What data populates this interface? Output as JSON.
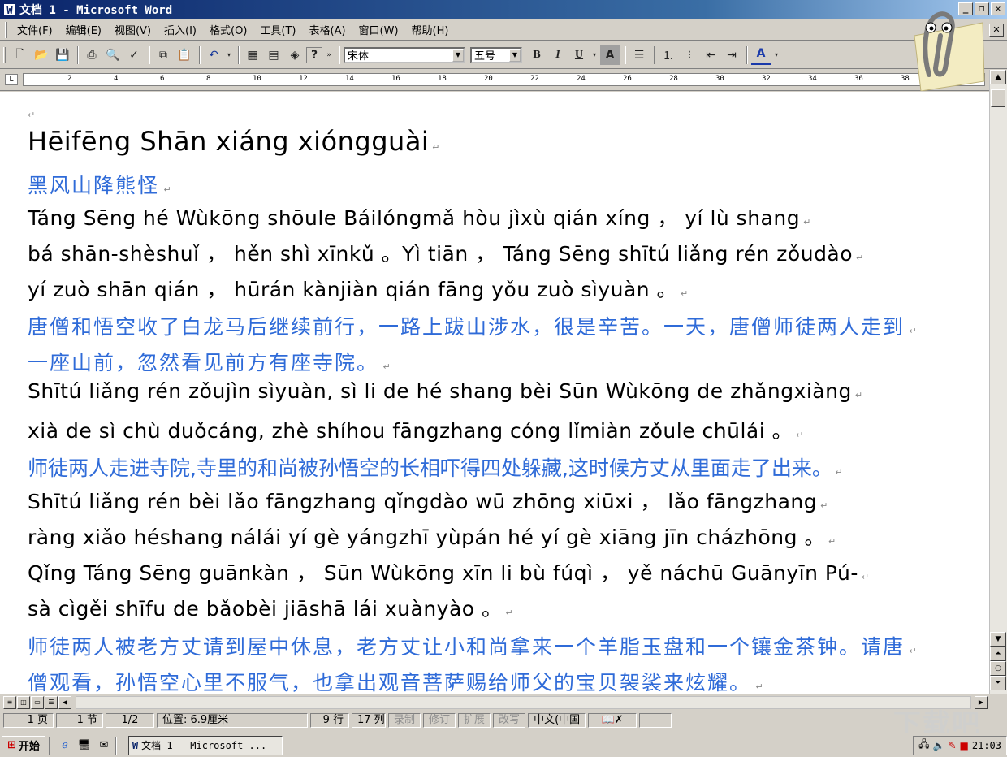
{
  "window": {
    "title": "文档 1 - Microsoft Word",
    "icon": "word-icon"
  },
  "menus": [
    "文件(F)",
    "编辑(E)",
    "视图(V)",
    "插入(I)",
    "格式(O)",
    "工具(T)",
    "表格(A)",
    "窗口(W)",
    "帮助(H)"
  ],
  "toolbar": {
    "font": "宋体",
    "size": "五号",
    "bold": "B",
    "italic": "I",
    "underline": "U",
    "shade": "A",
    "fontcolor": "A"
  },
  "ruler": {
    "ticks": [
      "2",
      "4",
      "6",
      "8",
      "10",
      "12",
      "14",
      "16",
      "18",
      "20",
      "22",
      "24",
      "26",
      "28",
      "30",
      "32",
      "34",
      "36",
      "38"
    ]
  },
  "doc": {
    "title": "Hēifēng Shān xiáng xióngguài",
    "title_cn": "黑风山降熊怪",
    "p1": [
      "Táng Sēng hé Wùkōng shōule Báilóngmǎ hòu jìxù qián xíng ， yí lù shang",
      "bá shān-shèshuǐ ， hěn shì xīnkǔ 。Yì tiān ， Táng Sēng shītú liǎng rén zǒudào",
      "yí zuò shān qián ， hūrán kànjiàn qián fāng yǒu zuò sìyuàn 。"
    ],
    "p1cn": [
      "唐僧和悟空收了白龙马后继续前行，一路上跋山涉水，很是辛苦。一天，唐僧师徒两人走到",
      "一座山前，忽然看见前方有座寺院。"
    ],
    "p2": [
      "Shītú liǎng rén zǒujìn sìyuàn,  sì li de hé shang bèi Sūn Wùkōng de zhǎngxiàng",
      "xià de sì chù duǒcáng, zhè shíhou fāngzhang cóng lǐmiàn zǒule chūlái 。"
    ],
    "p2cn": "师徒两人走进寺院,寺里的和尚被孙悟空的长相吓得四处躲藏,这时候方丈从里面走了出来。",
    "p3": [
      "Shītú liǎng rén bèi lǎo fāngzhang qǐngdào wū zhōng xiūxi ， lǎo fāngzhang",
      "ràng xiǎo héshang nálái yí gè yángzhī yùpán hé yí gè xiāng jīn cházhōng 。",
      "Qǐng Táng Sēng guānkàn ， Sūn Wùkōng xīn li bù fúqì ， yě náchū Guānyīn Pú-",
      "sà cìgěi shīfu de bǎobèi jiāshā lái xuànyào 。"
    ],
    "p3cn": [
      "师徒两人被老方丈请到屋中休息，老方丈让小和尚拿来一个羊脂玉盘和一个镶金茶钟。请唐",
      "僧观看，孙悟空心里不服气，也拿出观音菩萨赐给师父的宝贝袈裟来炫耀。"
    ]
  },
  "status": {
    "page": "1 页",
    "section": "1 节",
    "pages": "1/2",
    "position": "位置: 6.9厘米",
    "line": "9 行",
    "col": "17 列",
    "rec": "录制",
    "trk": "修订",
    "ext": "扩展",
    "ovr": "改写",
    "lang": "中文(中国"
  },
  "taskbar": {
    "start": "开始",
    "task": "文档 1 - Microsoft ...",
    "clock": "21:03"
  },
  "colors": {
    "chinese_text": "#2f6bd8",
    "title_bar": "#0a246a"
  }
}
